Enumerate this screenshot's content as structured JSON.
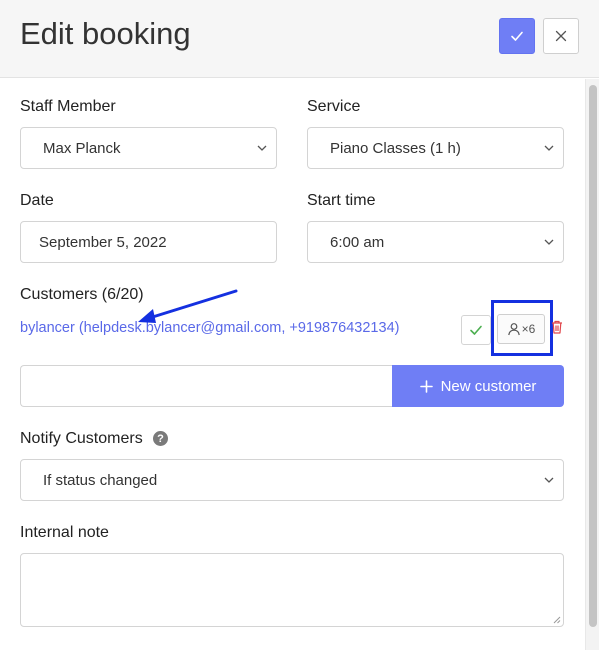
{
  "header": {
    "title": "Edit booking",
    "save_icon": "check-icon",
    "close_icon": "close-icon"
  },
  "form": {
    "staff": {
      "label": "Staff Member",
      "value": "Max Planck"
    },
    "service": {
      "label": "Service",
      "value": "Piano Classes (1 h)"
    },
    "date": {
      "label": "Date",
      "value": "September 5, 2022"
    },
    "start_time": {
      "label": "Start time",
      "value": "6:00 am"
    },
    "customers": {
      "label": "Customers (6/20)",
      "entry": "bylancer (helpdesk.bylancer@gmail.com, +919876432134)",
      "count_label": "×6",
      "new_customer_label": "New customer"
    },
    "notify": {
      "label": "Notify Customers",
      "help": "?",
      "value": "If status changed"
    },
    "note": {
      "label": "Internal note",
      "value": ""
    }
  },
  "colors": {
    "accent": "#6f7ef5",
    "link": "#5a69e8",
    "highlight_box": "#1430e0",
    "success": "#4caf50",
    "danger": "#e0474c"
  }
}
